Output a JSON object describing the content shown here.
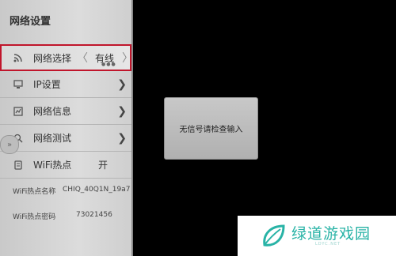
{
  "panel": {
    "title": "网络设置",
    "network_select": {
      "label": "网络选择",
      "value": "有线",
      "icon": "wifi-signal-icon"
    },
    "items": [
      {
        "label": "IP设置",
        "icon": "ip-settings-icon"
      },
      {
        "label": "网络信息",
        "icon": "network-info-icon"
      },
      {
        "label": "网络测试",
        "icon": "network-test-icon"
      }
    ],
    "wifi_hotspot": {
      "label": "WiFi热点",
      "value": "开",
      "icon": "hotspot-icon"
    },
    "hotspot_name": {
      "label": "WiFi热点名称",
      "value": "CHIQ_40Q1N_19a7"
    },
    "hotspot_password": {
      "label": "WiFi热点密码",
      "value": "73021456"
    }
  },
  "dialog": {
    "message": "无信号请检查输入"
  },
  "watermark": {
    "title": "绿道游戏园",
    "subtitle": "LDYC.NET"
  }
}
